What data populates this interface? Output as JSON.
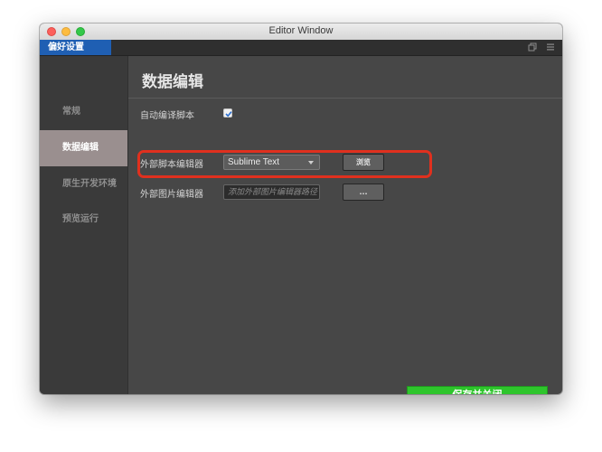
{
  "window": {
    "title": "Editor Window"
  },
  "tabs": [
    {
      "label": "偏好设置"
    }
  ],
  "toolbar_icons": {
    "restore": "restore-window-icon",
    "menu": "hamburger-menu-icon"
  },
  "sidebar": {
    "items": [
      {
        "label": "常规",
        "active": false
      },
      {
        "label": "数据编辑",
        "active": true
      },
      {
        "label": "原生开发环境",
        "active": false
      },
      {
        "label": "预览运行",
        "active": false
      }
    ]
  },
  "page": {
    "title": "数据编辑",
    "auto_compile": {
      "label": "自动编译脚本",
      "checked": true
    },
    "script_editor": {
      "label": "外部脚本编辑器",
      "selected": "Sublime Text",
      "browse_label": "浏览"
    },
    "image_editor": {
      "label": "外部图片编辑器",
      "placeholder": "添加外部图片编辑器路径",
      "button_label": "..."
    }
  },
  "footer": {
    "save_label": "保存并关闭"
  },
  "colors": {
    "tab_active": "#1f5fb3",
    "save_button": "#2ec52c",
    "highlight": "#e0301e",
    "nav_active": "#9a8f8f"
  }
}
